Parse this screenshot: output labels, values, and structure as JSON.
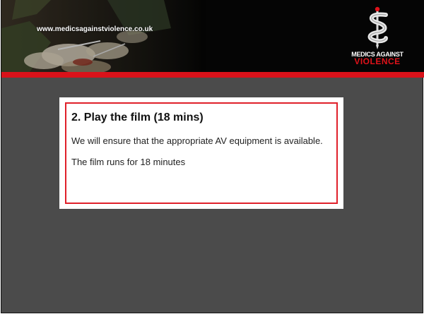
{
  "header": {
    "url": "www.medicsagainstviolence.co.uk",
    "logo": {
      "icon": "caduceus-knife-icon",
      "line1": "MEDICS AGAINST",
      "line2": "VIOLENCE"
    }
  },
  "content": {
    "title": "2. Play the film (18 mins)",
    "paragraphs": [
      "We will ensure that the appropriate AV equipment is available.",
      "The film runs for 18 minutes"
    ]
  },
  "colors": {
    "accent_red": "#d9121a",
    "background": "#4b4b4b",
    "header": "#050505"
  }
}
